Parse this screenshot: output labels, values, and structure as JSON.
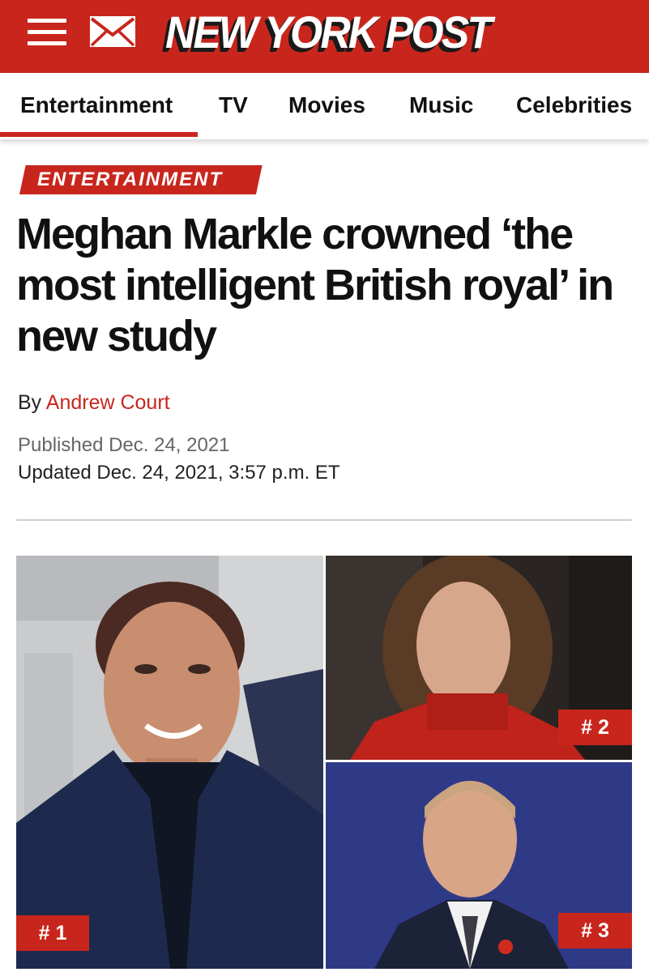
{
  "header": {
    "menu_icon": "hamburger-menu-icon",
    "mail_icon": "envelope-icon",
    "logo_text": "NEW YORK POST",
    "brand_color": "#c8261d"
  },
  "nav": {
    "items": [
      {
        "label": "Entertainment",
        "active": true
      },
      {
        "label": "TV",
        "active": false
      },
      {
        "label": "Movies",
        "active": false
      },
      {
        "label": "Music",
        "active": false
      },
      {
        "label": "Celebrities",
        "active": false
      }
    ]
  },
  "article": {
    "kicker": "ENTERTAINMENT",
    "headline": "Meghan Markle crowned ‘the most intelligent British royal’ in new study",
    "byline_prefix": "By",
    "author": "Andrew Court",
    "published": "Published Dec. 24, 2021",
    "updated": "Updated Dec. 24, 2021, 3:57 p.m. ET"
  },
  "photos": [
    {
      "rank_label": "# 1"
    },
    {
      "rank_label": "# 2"
    },
    {
      "rank_label": "# 3"
    }
  ]
}
